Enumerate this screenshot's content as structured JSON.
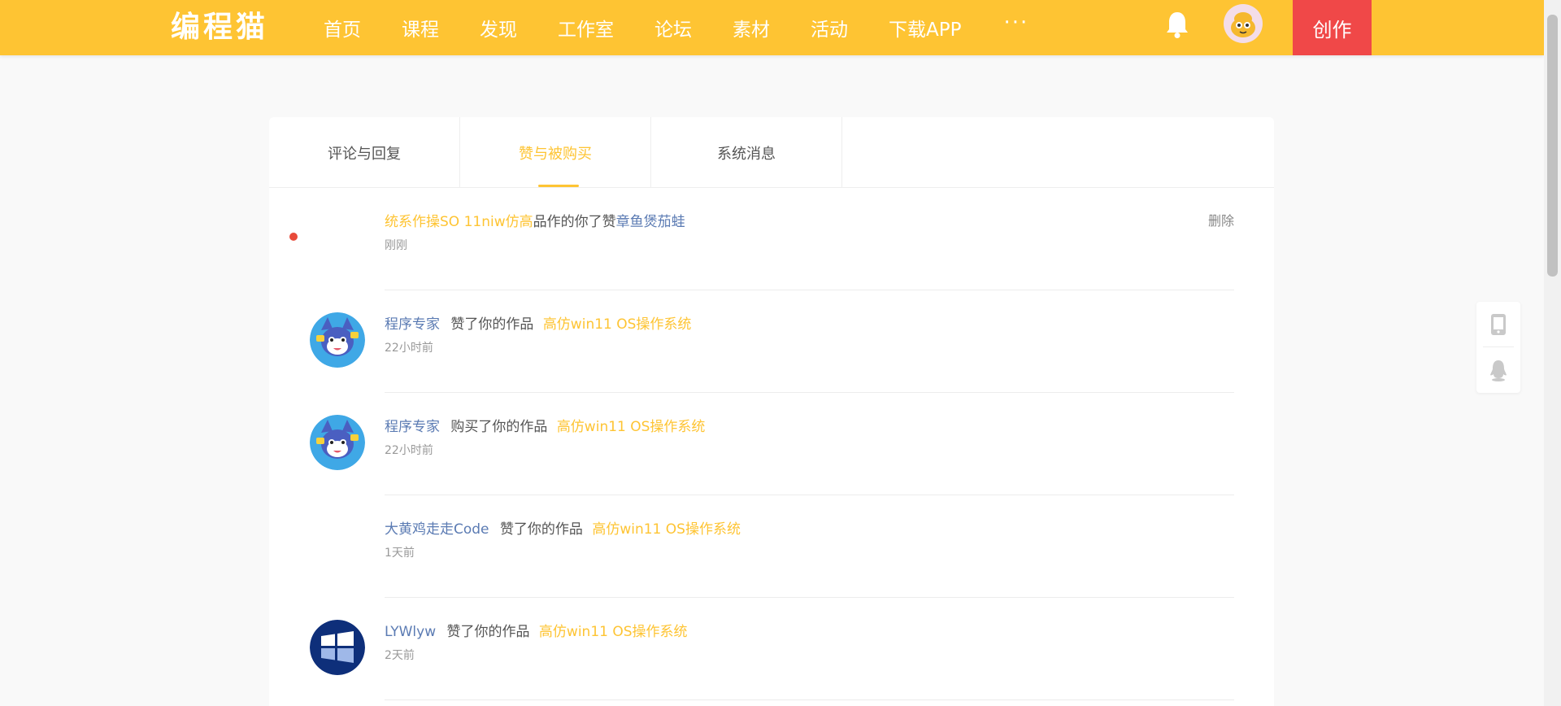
{
  "nav": {
    "logo": "编程猫",
    "items": [
      "首页",
      "课程",
      "发现",
      "工作室",
      "论坛",
      "素材",
      "活动",
      "下载APP"
    ],
    "more": "···",
    "create": "创作"
  },
  "tabs": [
    {
      "label": "评论与回复",
      "active": false
    },
    {
      "label": "赞与被购买",
      "active": true
    },
    {
      "label": "系统消息",
      "active": false
    }
  ],
  "messages": [
    {
      "work": "统系作操SO 11niw仿高",
      "action": "品作的你了赞",
      "user": "章鱼煲茄蛙",
      "time": "刚刚",
      "delete": "删除",
      "unread": true,
      "avatar": "none",
      "reversed": true
    },
    {
      "user": "程序专家",
      "action": "赞了你的作品",
      "work": "高仿win11 OS操作系统",
      "time": "22小时前",
      "avatar": "cartoon-cat"
    },
    {
      "user": "程序专家",
      "action": "购买了你的作品",
      "work": "高仿win11 OS操作系统",
      "time": "22小时前",
      "avatar": "cartoon-cat"
    },
    {
      "user": "大黄鸡走走Code",
      "action": "赞了你的作品",
      "work": "高仿win11 OS操作系统",
      "time": "1天前",
      "avatar": "none"
    },
    {
      "user": "LYWlyw",
      "action": "赞了你的作品",
      "work": "高仿win11 OS操作系统",
      "time": "2天前",
      "avatar": "windows-logo"
    }
  ],
  "colors": {
    "brand": "#fec433",
    "create": "#f04848",
    "user": "#5b7bb3",
    "unread": "#e84a3a"
  }
}
